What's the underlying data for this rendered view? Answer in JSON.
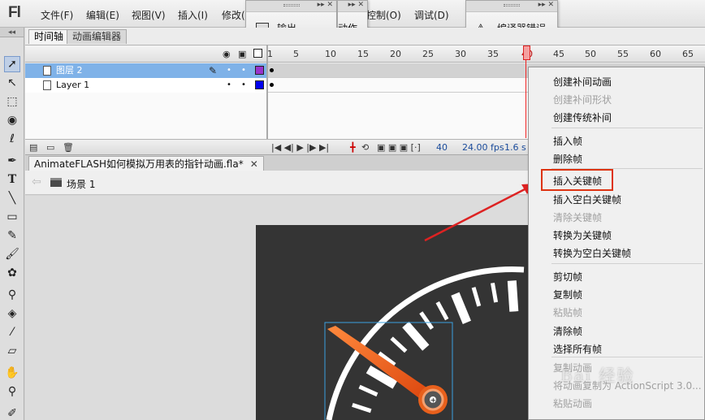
{
  "menubar": {
    "logo": "Fl",
    "items": [
      "文件(F)",
      "编辑(E)",
      "视图(V)",
      "插入(I)",
      "修改(",
      "控制(O)",
      "调试(D)"
    ]
  },
  "panels": {
    "output": "输出",
    "output_partial": "动作",
    "compiler": "编译器错误"
  },
  "timeline": {
    "tabs": [
      "时间轴",
      "动画编辑器"
    ],
    "frame_numbers": [
      "1",
      "5",
      "10",
      "15",
      "20",
      "25",
      "30",
      "35",
      "40",
      "45",
      "50",
      "55",
      "60",
      "65"
    ],
    "current_frame": 40,
    "layers": [
      {
        "name": "图层 2",
        "color": "#9933cc",
        "selected": true
      },
      {
        "name": "Layer 1",
        "color": "#0000ee",
        "selected": false
      }
    ],
    "footer": {
      "frame": "40",
      "fps": "24.00 fps",
      "time": "1.6 s"
    }
  },
  "document": {
    "tab_title": "AnimateFLASH如何模拟万用表的指针动画.fla*",
    "scene": "场景 1"
  },
  "context_menu": {
    "items": [
      {
        "label": "创建补间动画",
        "enabled": true
      },
      {
        "label": "创建补间形状",
        "enabled": false
      },
      {
        "label": "创建传统补间",
        "enabled": true
      },
      {
        "label": "插入帧",
        "enabled": true
      },
      {
        "label": "删除帧",
        "enabled": true
      },
      {
        "label": "插入关键帧",
        "enabled": true,
        "highlighted": true
      },
      {
        "label": "插入空白关键帧",
        "enabled": true
      },
      {
        "label": "清除关键帧",
        "enabled": false
      },
      {
        "label": "转换为关键帧",
        "enabled": true
      },
      {
        "label": "转换为空白关键帧",
        "enabled": true
      },
      {
        "label": "剪切帧",
        "enabled": true
      },
      {
        "label": "复制帧",
        "enabled": true
      },
      {
        "label": "粘贴帧",
        "enabled": false
      },
      {
        "label": "清除帧",
        "enabled": true
      },
      {
        "label": "选择所有帧",
        "enabled": true
      },
      {
        "label": "复制动画",
        "enabled": false
      },
      {
        "label": "将动画复制为 ActionScript 3.0...",
        "enabled": false
      },
      {
        "label": "粘贴动画",
        "enabled": false
      }
    ]
  },
  "colors": {
    "highlight_box": "#dd3311",
    "needle": "#ee5511",
    "stage": "#343434"
  },
  "watermark": "Bai 经验"
}
